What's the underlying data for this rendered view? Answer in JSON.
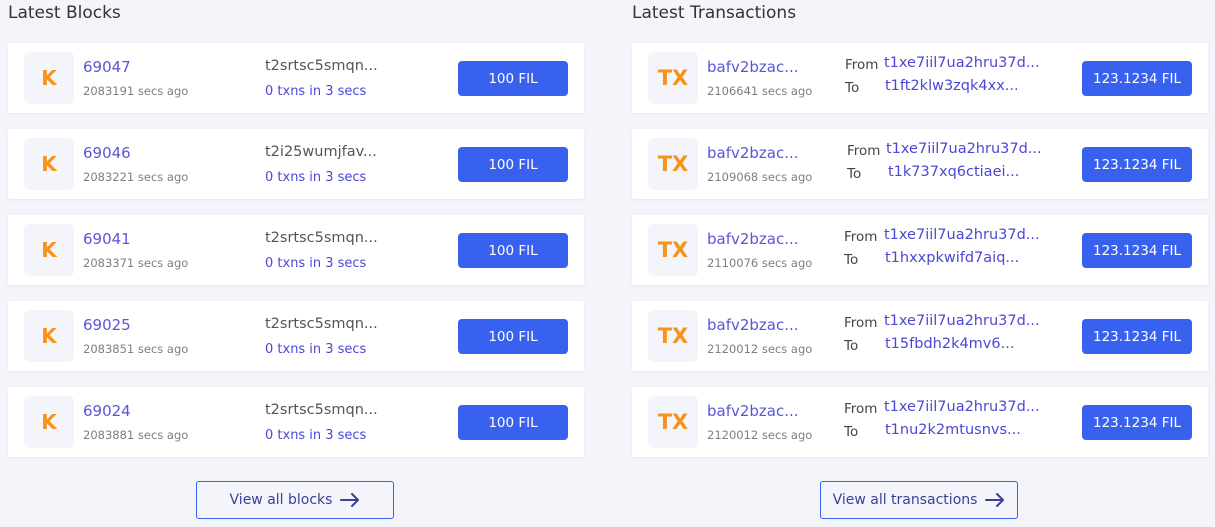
{
  "blocks": {
    "title": "Latest Blocks",
    "badge_glyph": "K",
    "view_all_label": "View all blocks",
    "items": [
      {
        "height": "69047",
        "age": "2083191 secs ago",
        "miner": "t2srtsc5smqn...",
        "txns": "0 txns",
        "time": "in 3 secs",
        "reward": "100 FIL"
      },
      {
        "height": "69046",
        "age": "2083221 secs ago",
        "miner": "t2i25wumjfav...",
        "txns": "0 txns",
        "time": "in 3 secs",
        "reward": "100 FIL"
      },
      {
        "height": "69041",
        "age": "2083371 secs ago",
        "miner": "t2srtsc5smqn...",
        "txns": "0 txns",
        "time": "in 3 secs",
        "reward": "100 FIL"
      },
      {
        "height": "69025",
        "age": "2083851 secs ago",
        "miner": "t2srtsc5smqn...",
        "txns": "0 txns",
        "time": "in 3 secs",
        "reward": "100 FIL"
      },
      {
        "height": "69024",
        "age": "2083881 secs ago",
        "miner": "t2srtsc5smqn...",
        "txns": "0 txns",
        "time": "in 3 secs",
        "reward": "100 FIL"
      }
    ]
  },
  "transactions": {
    "title": "Latest Transactions",
    "badge_glyph": "TX",
    "from_label": "From",
    "to_label": "To",
    "view_all_label": "View all transactions",
    "items": [
      {
        "hash": "bafv2bzac...",
        "age": "2106641 secs ago",
        "from": "t1xe7iil7ua2hru37d...",
        "to": "t1ft2klw3zqk4xx...",
        "amount": "123.1234 FIL"
      },
      {
        "hash": "bafv2bzac...",
        "age": "2109068 secs ago",
        "from": "t1xe7iil7ua2hru37d...",
        "to": "t1k737xq6ctiaei...",
        "amount": "123.1234 FIL"
      },
      {
        "hash": "bafv2bzac...",
        "age": "2110076 secs ago",
        "from": "t1xe7iil7ua2hru37d...",
        "to": "t1hxxpkwifd7aiq...",
        "amount": "123.1234 FIL"
      },
      {
        "hash": "bafv2bzac...",
        "age": "2120012 secs ago",
        "from": "t1xe7iil7ua2hru37d...",
        "to": "t15fbdh2k4mv6...",
        "amount": "123.1234 FIL"
      },
      {
        "hash": "bafv2bzac...",
        "age": "2120012 secs ago",
        "from": "t1xe7iil7ua2hru37d...",
        "to": "t1nu2k2mtusnvs...",
        "amount": "123.1234 FIL"
      }
    ]
  },
  "icons": {
    "arrow": "arrow-right-icon",
    "block_badge": "block-k-icon",
    "tx_badge": "tx-icon"
  },
  "colors": {
    "accent": "#3861f0",
    "link": "#5a55d6",
    "badge": "#f7931a",
    "background": "#f3f5fa"
  }
}
